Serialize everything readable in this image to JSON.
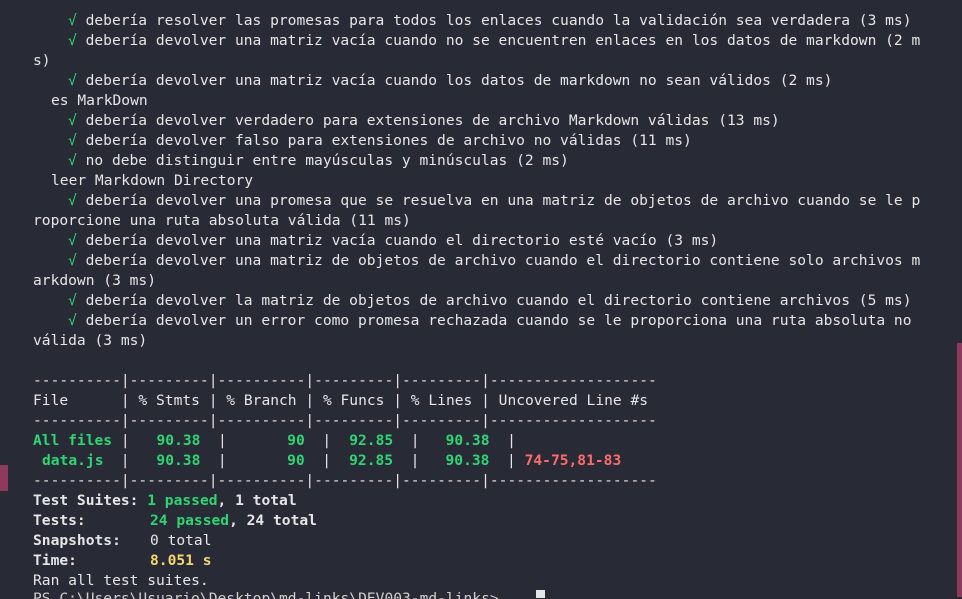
{
  "tests": [
    {
      "check": "√",
      "text": "debería resolver las promesas para todos los enlaces cuando la validación sea verdadera (3 ms)"
    },
    {
      "check": "√",
      "text": "debería devolver una matriz vacía cuando no se encuentren enlaces en los datos de markdown (2 m"
    },
    {
      "check": "",
      "text": "s)"
    },
    {
      "check": "√",
      "text": "debería devolver una matriz vacía cuando los datos de markdown no sean válidos (2 ms)"
    }
  ],
  "group_md": "es MarkDown",
  "tests_md": [
    {
      "check": "√",
      "text": "debería devolver verdadero para extensiones de archivo Markdown válidas (13 ms)"
    },
    {
      "check": "√",
      "text": "debería devolver falso para extensiones de archivo no válidas (11 ms)"
    },
    {
      "check": "√",
      "text": "no debe distinguir entre mayúsculas y minúsculas (2 ms)"
    }
  ],
  "group_dir": "leer Markdown Directory",
  "tests_dir": [
    {
      "check": "√",
      "text": "debería devolver una promesa que se resuelva en una matriz de objetos de archivo cuando se le p"
    },
    {
      "check": "",
      "text": "roporcione una ruta absoluta válida (11 ms)"
    },
    {
      "check": "√",
      "text": "debería devolver una matriz vacía cuando el directorio esté vacío (3 ms)"
    },
    {
      "check": "√",
      "text": "debería devolver una matriz de objetos de archivo cuando el directorio contiene solo archivos m"
    },
    {
      "check": "",
      "text": "arkdown (3 ms)"
    },
    {
      "check": "√",
      "text": "debería devolver la matriz de objetos de archivo cuando el directorio contiene archivos (5 ms)"
    },
    {
      "check": "√",
      "text": "debería devolver un error como promesa rechazada cuando se le proporciona una ruta absoluta no"
    },
    {
      "check": "",
      "text": "válida (3 ms)"
    }
  ],
  "coverage": {
    "sep": "----------|---------|----------|---------|---------|-------------------",
    "header": "File      | % Stmts | % Branch | % Funcs | % Lines | Uncovered Line #s ",
    "rows": [
      {
        "file": "All files",
        "stmts": "90.38",
        "branch": "90",
        "funcs": "92.85",
        "lines": "90.38",
        "uncovered": ""
      },
      {
        "file": "data.js",
        "stmts": "90.38",
        "branch": "90",
        "funcs": "92.85",
        "lines": "90.38",
        "uncovered": "74-75,81-83"
      }
    ]
  },
  "summary": {
    "suites_label": "Test Suites:",
    "suites_passed": "1 passed",
    "suites_total": ", 1 total",
    "tests_label": "Tests:",
    "tests_passed": "24 passed",
    "tests_total": ", 24 total",
    "snap_label": "Snapshots:",
    "snap_value": "0 total",
    "time_label": "Time:",
    "time_value": "8.051 s",
    "ran": "Ran all test suites."
  },
  "prompt_partial": "PS C:\\Users\\Usuario\\Desktop\\md-links\\DEV003-md-links>"
}
